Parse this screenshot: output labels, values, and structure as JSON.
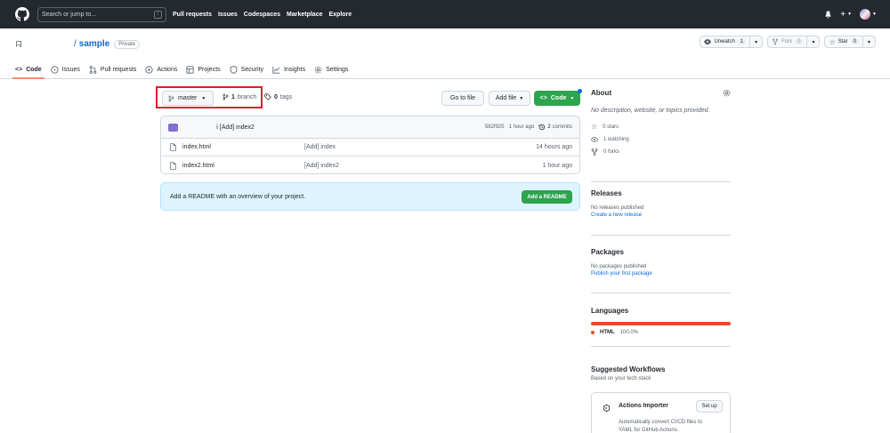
{
  "header": {
    "search_placeholder": "Search or jump to...",
    "search_shortcut": "/",
    "nav": [
      "Pull requests",
      "Issues",
      "Codespaces",
      "Marketplace",
      "Explore"
    ],
    "plus_label": "+"
  },
  "repo": {
    "slash": "/",
    "name": "sample",
    "visibility": "Private",
    "unwatch_label": "Unwatch",
    "unwatch_count": "1",
    "fork_label": "Fork",
    "fork_count": "0",
    "star_label": "Star",
    "star_count": "0"
  },
  "tabs": [
    "Code",
    "Issues",
    "Pull requests",
    "Actions",
    "Projects",
    "Security",
    "Insights",
    "Settings"
  ],
  "toolbar": {
    "branch_name": "master",
    "branch_count": "1",
    "branch_label": "branch",
    "tag_count": "0",
    "tag_label": "tags",
    "go_to_file": "Go to file",
    "add_file": "Add file",
    "code": "Code"
  },
  "commit": {
    "message": "[Add] index2",
    "sha": "582f925",
    "age": "1 hour ago",
    "count": "2",
    "count_label": "commits"
  },
  "files": [
    {
      "name": "index.html",
      "message": "[Add] index",
      "age": "14 hours ago"
    },
    {
      "name": "index2.html",
      "message": "[Add] index2",
      "age": "1 hour ago"
    }
  ],
  "readme": {
    "text": "Add a README with an overview of your project.",
    "button": "Add a README"
  },
  "sidebar": {
    "about_title": "About",
    "about_text": "No description, website, or topics provided.",
    "stars": "0 stars",
    "watching": "1 watching",
    "forks": "0 forks",
    "releases_title": "Releases",
    "releases_text": "No releases published",
    "releases_link": "Create a new release",
    "packages_title": "Packages",
    "packages_text": "No packages published",
    "packages_link": "Publish your first package",
    "languages_title": "Languages",
    "language_name": "HTML",
    "language_pct": "100.0%",
    "language_color": "#e34c26",
    "workflows_title": "Suggested Workflows",
    "workflows_sub": "Based on your tech stack",
    "workflow_name": "Actions Importer",
    "workflow_desc": "Automatically convert CI/CD files to YAML for GitHub Actions.",
    "setup_label": "Set up"
  },
  "colors": {
    "header_bg": "#24292f",
    "primary_green": "#2da44e",
    "link_blue": "#0969da",
    "highlight_red": "#e11d2a",
    "active_tab_underline": "#fd8c73"
  }
}
